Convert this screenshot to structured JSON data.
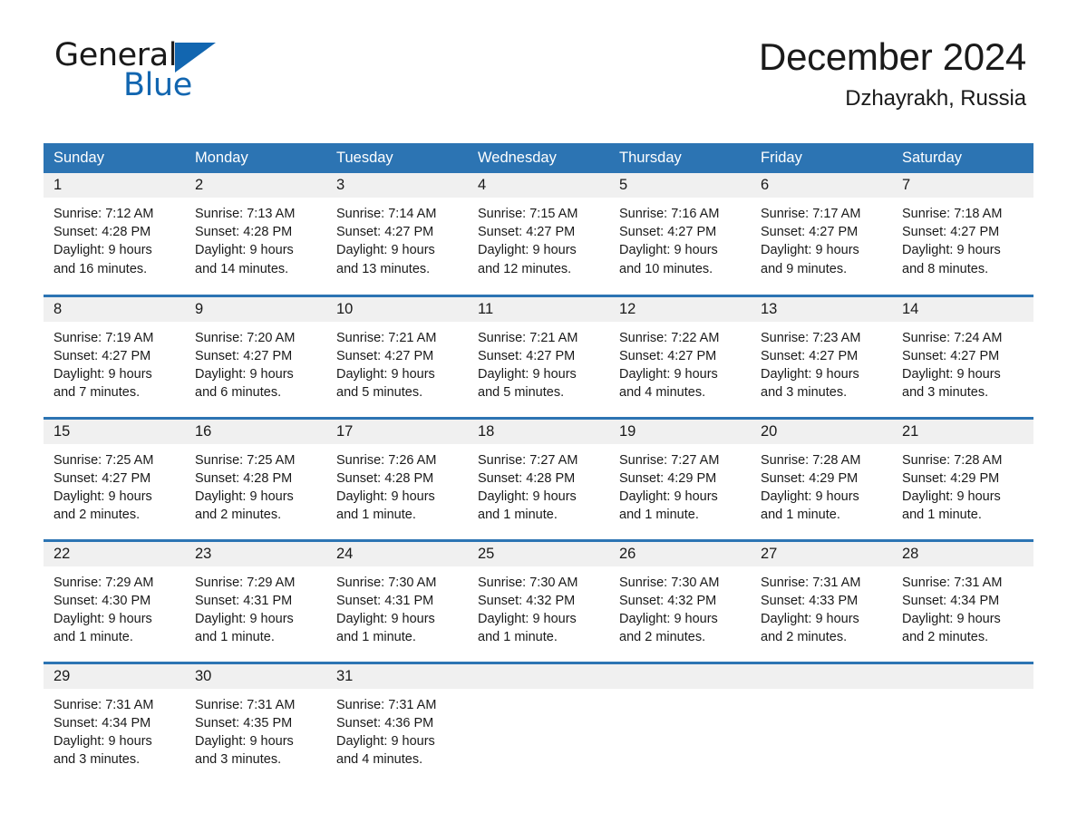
{
  "brand": {
    "name_part1": "General",
    "name_part2": "Blue",
    "triangle_color": "#1266b0",
    "accent_color": "#2c74b3"
  },
  "header": {
    "title": "December 2024",
    "subtitle": "Dzhayrakh, Russia"
  },
  "calendar": {
    "weekday_headers": [
      "Sunday",
      "Monday",
      "Tuesday",
      "Wednesday",
      "Thursday",
      "Friday",
      "Saturday"
    ],
    "weeks": [
      [
        {
          "day": "1",
          "sunrise": "Sunrise: 7:12 AM",
          "sunset": "Sunset: 4:28 PM",
          "daylight_line1": "Daylight: 9 hours",
          "daylight_line2": "and 16 minutes."
        },
        {
          "day": "2",
          "sunrise": "Sunrise: 7:13 AM",
          "sunset": "Sunset: 4:28 PM",
          "daylight_line1": "Daylight: 9 hours",
          "daylight_line2": "and 14 minutes."
        },
        {
          "day": "3",
          "sunrise": "Sunrise: 7:14 AM",
          "sunset": "Sunset: 4:27 PM",
          "daylight_line1": "Daylight: 9 hours",
          "daylight_line2": "and 13 minutes."
        },
        {
          "day": "4",
          "sunrise": "Sunrise: 7:15 AM",
          "sunset": "Sunset: 4:27 PM",
          "daylight_line1": "Daylight: 9 hours",
          "daylight_line2": "and 12 minutes."
        },
        {
          "day": "5",
          "sunrise": "Sunrise: 7:16 AM",
          "sunset": "Sunset: 4:27 PM",
          "daylight_line1": "Daylight: 9 hours",
          "daylight_line2": "and 10 minutes."
        },
        {
          "day": "6",
          "sunrise": "Sunrise: 7:17 AM",
          "sunset": "Sunset: 4:27 PM",
          "daylight_line1": "Daylight: 9 hours",
          "daylight_line2": "and 9 minutes."
        },
        {
          "day": "7",
          "sunrise": "Sunrise: 7:18 AM",
          "sunset": "Sunset: 4:27 PM",
          "daylight_line1": "Daylight: 9 hours",
          "daylight_line2": "and 8 minutes."
        }
      ],
      [
        {
          "day": "8",
          "sunrise": "Sunrise: 7:19 AM",
          "sunset": "Sunset: 4:27 PM",
          "daylight_line1": "Daylight: 9 hours",
          "daylight_line2": "and 7 minutes."
        },
        {
          "day": "9",
          "sunrise": "Sunrise: 7:20 AM",
          "sunset": "Sunset: 4:27 PM",
          "daylight_line1": "Daylight: 9 hours",
          "daylight_line2": "and 6 minutes."
        },
        {
          "day": "10",
          "sunrise": "Sunrise: 7:21 AM",
          "sunset": "Sunset: 4:27 PM",
          "daylight_line1": "Daylight: 9 hours",
          "daylight_line2": "and 5 minutes."
        },
        {
          "day": "11",
          "sunrise": "Sunrise: 7:21 AM",
          "sunset": "Sunset: 4:27 PM",
          "daylight_line1": "Daylight: 9 hours",
          "daylight_line2": "and 5 minutes."
        },
        {
          "day": "12",
          "sunrise": "Sunrise: 7:22 AM",
          "sunset": "Sunset: 4:27 PM",
          "daylight_line1": "Daylight: 9 hours",
          "daylight_line2": "and 4 minutes."
        },
        {
          "day": "13",
          "sunrise": "Sunrise: 7:23 AM",
          "sunset": "Sunset: 4:27 PM",
          "daylight_line1": "Daylight: 9 hours",
          "daylight_line2": "and 3 minutes."
        },
        {
          "day": "14",
          "sunrise": "Sunrise: 7:24 AM",
          "sunset": "Sunset: 4:27 PM",
          "daylight_line1": "Daylight: 9 hours",
          "daylight_line2": "and 3 minutes."
        }
      ],
      [
        {
          "day": "15",
          "sunrise": "Sunrise: 7:25 AM",
          "sunset": "Sunset: 4:27 PM",
          "daylight_line1": "Daylight: 9 hours",
          "daylight_line2": "and 2 minutes."
        },
        {
          "day": "16",
          "sunrise": "Sunrise: 7:25 AM",
          "sunset": "Sunset: 4:28 PM",
          "daylight_line1": "Daylight: 9 hours",
          "daylight_line2": "and 2 minutes."
        },
        {
          "day": "17",
          "sunrise": "Sunrise: 7:26 AM",
          "sunset": "Sunset: 4:28 PM",
          "daylight_line1": "Daylight: 9 hours",
          "daylight_line2": "and 1 minute."
        },
        {
          "day": "18",
          "sunrise": "Sunrise: 7:27 AM",
          "sunset": "Sunset: 4:28 PM",
          "daylight_line1": "Daylight: 9 hours",
          "daylight_line2": "and 1 minute."
        },
        {
          "day": "19",
          "sunrise": "Sunrise: 7:27 AM",
          "sunset": "Sunset: 4:29 PM",
          "daylight_line1": "Daylight: 9 hours",
          "daylight_line2": "and 1 minute."
        },
        {
          "day": "20",
          "sunrise": "Sunrise: 7:28 AM",
          "sunset": "Sunset: 4:29 PM",
          "daylight_line1": "Daylight: 9 hours",
          "daylight_line2": "and 1 minute."
        },
        {
          "day": "21",
          "sunrise": "Sunrise: 7:28 AM",
          "sunset": "Sunset: 4:29 PM",
          "daylight_line1": "Daylight: 9 hours",
          "daylight_line2": "and 1 minute."
        }
      ],
      [
        {
          "day": "22",
          "sunrise": "Sunrise: 7:29 AM",
          "sunset": "Sunset: 4:30 PM",
          "daylight_line1": "Daylight: 9 hours",
          "daylight_line2": "and 1 minute."
        },
        {
          "day": "23",
          "sunrise": "Sunrise: 7:29 AM",
          "sunset": "Sunset: 4:31 PM",
          "daylight_line1": "Daylight: 9 hours",
          "daylight_line2": "and 1 minute."
        },
        {
          "day": "24",
          "sunrise": "Sunrise: 7:30 AM",
          "sunset": "Sunset: 4:31 PM",
          "daylight_line1": "Daylight: 9 hours",
          "daylight_line2": "and 1 minute."
        },
        {
          "day": "25",
          "sunrise": "Sunrise: 7:30 AM",
          "sunset": "Sunset: 4:32 PM",
          "daylight_line1": "Daylight: 9 hours",
          "daylight_line2": "and 1 minute."
        },
        {
          "day": "26",
          "sunrise": "Sunrise: 7:30 AM",
          "sunset": "Sunset: 4:32 PM",
          "daylight_line1": "Daylight: 9 hours",
          "daylight_line2": "and 2 minutes."
        },
        {
          "day": "27",
          "sunrise": "Sunrise: 7:31 AM",
          "sunset": "Sunset: 4:33 PM",
          "daylight_line1": "Daylight: 9 hours",
          "daylight_line2": "and 2 minutes."
        },
        {
          "day": "28",
          "sunrise": "Sunrise: 7:31 AM",
          "sunset": "Sunset: 4:34 PM",
          "daylight_line1": "Daylight: 9 hours",
          "daylight_line2": "and 2 minutes."
        }
      ],
      [
        {
          "day": "29",
          "sunrise": "Sunrise: 7:31 AM",
          "sunset": "Sunset: 4:34 PM",
          "daylight_line1": "Daylight: 9 hours",
          "daylight_line2": "and 3 minutes."
        },
        {
          "day": "30",
          "sunrise": "Sunrise: 7:31 AM",
          "sunset": "Sunset: 4:35 PM",
          "daylight_line1": "Daylight: 9 hours",
          "daylight_line2": "and 3 minutes."
        },
        {
          "day": "31",
          "sunrise": "Sunrise: 7:31 AM",
          "sunset": "Sunset: 4:36 PM",
          "daylight_line1": "Daylight: 9 hours",
          "daylight_line2": "and 4 minutes."
        },
        {
          "day": "",
          "sunrise": "",
          "sunset": "",
          "daylight_line1": "",
          "daylight_line2": ""
        },
        {
          "day": "",
          "sunrise": "",
          "sunset": "",
          "daylight_line1": "",
          "daylight_line2": ""
        },
        {
          "day": "",
          "sunrise": "",
          "sunset": "",
          "daylight_line1": "",
          "daylight_line2": ""
        },
        {
          "day": "",
          "sunrise": "",
          "sunset": "",
          "daylight_line1": "",
          "daylight_line2": ""
        }
      ]
    ]
  }
}
